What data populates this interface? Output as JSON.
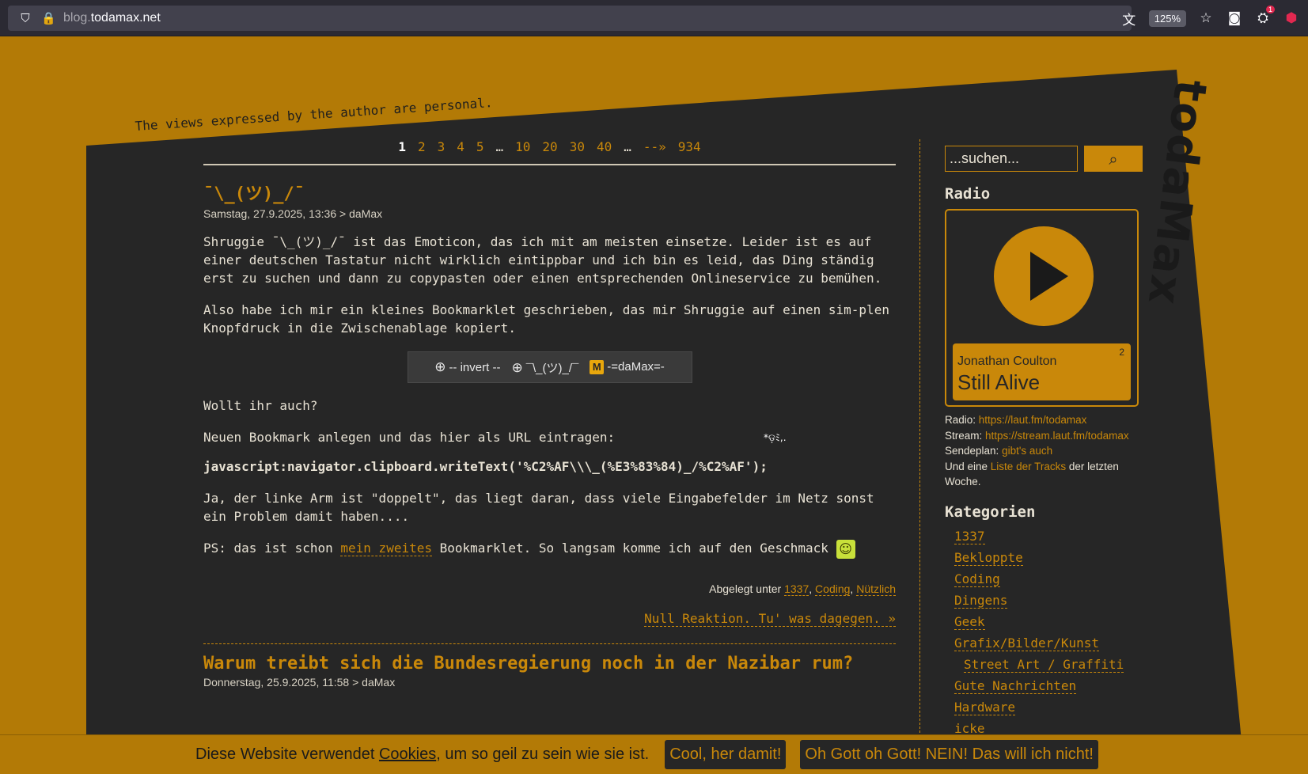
{
  "browser": {
    "url_sub": "blog.",
    "url_domain": "todamax.net",
    "zoom": "125%",
    "ext_badge": "1",
    "ublock_label": "uo"
  },
  "site": {
    "tagline": "The views expressed by the author are personal.",
    "logo": "todaMax"
  },
  "pager": {
    "items": [
      "1",
      "2",
      "3",
      "4",
      "5",
      "…",
      "10",
      "20",
      "30",
      "40",
      "…",
      "--»",
      "934"
    ]
  },
  "post1": {
    "title": "¯\\_(ツ)_/¯",
    "meta": "Samstag, 27.9.2025, 13:36 > daMax",
    "p1": "Shruggie ¯\\_(ツ)_/¯ ist das Emoticon, das ich mit am meisten einsetze. Leider ist es auf einer deutschen Tastatur nicht wirklich eintippbar und ich bin es leid, das Ding ständig erst zu suchen und dann zu copypasten oder einen entsprechenden Onlineservice zu bemühen.",
    "p2": "Also habe ich mir ein kleines Bookmarklet geschrieben, das mir Shruggie auf einen sim-plen Knopfdruck in die Zwischenablage kopiert.",
    "bm1": "-- invert --",
    "bm2": "¯\\_(ツ)_/¯",
    "bm3": "-=daMax=-",
    "bm3_logo": "M",
    "p3": "Wollt ihr auch?",
    "p4": "Neuen Bookmark anlegen und das hier als URL eintragen:",
    "code": "javascript:navigator.clipboard.writeText('%C2%AF\\\\\\_(%E3%83%84)_/%C2%AF');",
    "p5": "Ja, der linke Arm ist \"doppelt\", das liegt daran, dass viele Eingabefelder im Netz sonst ein Problem damit haben....",
    "p6_pre": "PS: das ist schon ",
    "p6_link": "mein zweites",
    "p6_post": " Bookmarklet. So langsam komme ich auf den Geschmack ",
    "sparkle": "*ଡ଼ﾐ,.",
    "filed_label": "Abgelegt unter ",
    "filed_cats": [
      "1337",
      "Coding",
      "Nützlich"
    ],
    "comments": "Null Reaktion. Tu' was dagegen. »"
  },
  "post2": {
    "title": "Warum treibt sich die Bundesregierung noch in der Nazibar rum?",
    "meta": "Donnerstag, 25.9.2025, 11:58 > daMax"
  },
  "sidebar": {
    "search_placeholder": "...suchen...",
    "radio_heading": "Radio",
    "artist": "Jonathan Coulton",
    "song": "Still Alive",
    "listeners": "2",
    "radio_label": "Radio: ",
    "radio_url": "https://laut.fm/todamax",
    "stream_label": "Stream: ",
    "stream_url": "https://stream.laut.fm/todamax",
    "sendeplan_label": "Sendeplan: ",
    "sendeplan_link": "gibt's auch",
    "tracks_pre": "Und eine ",
    "tracks_link": "Liste der Tracks",
    "tracks_post": " der letzten Woche.",
    "cat_heading": "Kategorien",
    "categories": [
      "1337",
      "Bekloppte",
      "Coding",
      "Dingens",
      "Geek",
      "Grafix/Bilder/Kunst",
      "Street Art / Graffiti",
      "Gute Nachrichten",
      "Hardware",
      "icke"
    ]
  },
  "cookie": {
    "text_pre": "Diese Website verwendet ",
    "text_link": "Cookies",
    "text_post": ", um so geil zu sein wie sie ist.",
    "accept": "Cool, her damit!",
    "reject": "Oh Gott oh Gott! NEIN! Das will ich nicht!"
  }
}
